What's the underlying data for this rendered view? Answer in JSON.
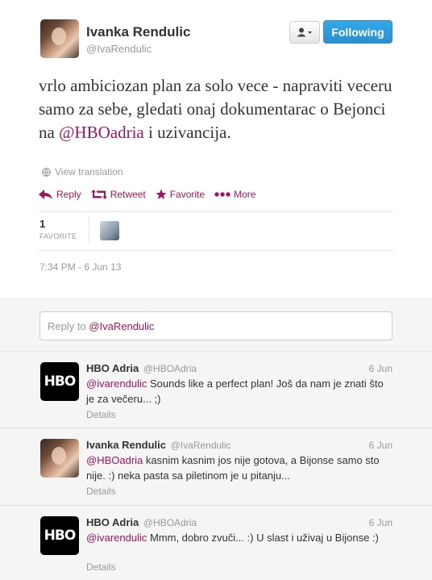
{
  "tweet": {
    "author_name": "Ivanka Rendulic",
    "author_handle": "@IvaRendulic",
    "follow_label": "Following",
    "text_before": "vrlo ambiciozan plan za solo vece - napraviti veceru samo za sebe, gledati onaj dokumentarac o Bejonci na ",
    "text_mention": "@HBOadria",
    "text_after": " i uzivancija.",
    "view_translation": "View translation",
    "actions": {
      "reply": "Reply",
      "retweet": "Retweet",
      "favorite": "Favorite",
      "more": "More"
    },
    "favorites_count": "1",
    "favorites_label": "FAVORITE",
    "timestamp": "7:34 PM - 6 Jun 13"
  },
  "reply_box": {
    "prefix": "Reply to ",
    "mention": "@IvaRendulic"
  },
  "replies": [
    {
      "name": "HBO Adria",
      "handle": "@HBOAdria",
      "time": "6 Jun",
      "mention": "@ivarendulic",
      "text": " Sounds like a perfect plan! Još da nam je znati što je za večeru... ;)",
      "details": "Details",
      "avatar_logo": "HBO"
    },
    {
      "name": "Ivanka Rendulic",
      "handle": "@IvaRendulic",
      "time": "6 Jun",
      "mention": "@HBOadria",
      "text": " kasnim kasnim jos nije gotova, a Bijonse samo sto nije. :) neka pasta sa piletinom je u pitanju...",
      "details": "Details"
    },
    {
      "name": "HBO Adria",
      "handle": "@HBOAdria",
      "time": "6 Jun",
      "mention": "@ivarendulic",
      "text": " Mmm, dobro zvuči... :) U slast i uživaj u Bijonse :)",
      "details": "Details",
      "avatar_logo": "HBO"
    }
  ],
  "colors": {
    "accent": "#a0155c",
    "follow_button": "#2a9ae0"
  }
}
